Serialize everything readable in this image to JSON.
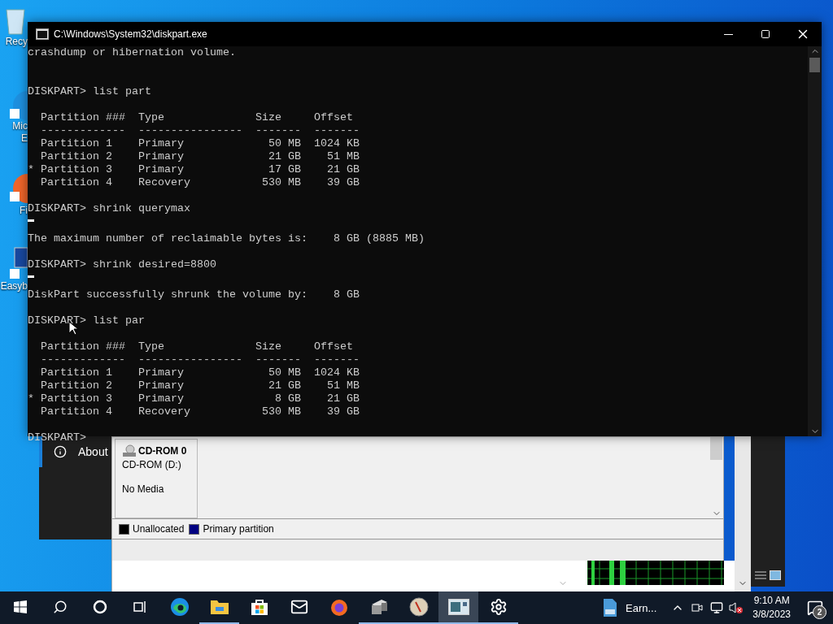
{
  "desktop_icons": [
    {
      "kind": "bin",
      "lines": [
        "Recy"
      ]
    },
    {
      "kind": "edge",
      "lines": [
        "Mic",
        "E"
      ]
    },
    {
      "kind": "firefox",
      "lines": [
        "Fi"
      ]
    },
    {
      "kind": "monitor",
      "lines": [
        "Easyb"
      ]
    }
  ],
  "settings_window": {
    "nav_item": {
      "label": "About",
      "selected": true
    }
  },
  "disk_management": {
    "device": {
      "name": "CD-ROM 0",
      "drive": "CD-ROM (D:)",
      "status": "No Media"
    },
    "legend": [
      {
        "label": "Unallocated",
        "color": "#000000"
      },
      {
        "label": "Primary partition",
        "color": "#000080"
      }
    ]
  },
  "console": {
    "title": "C:\\Windows\\System32\\diskpart.exe",
    "lines": [
      {
        "kind": "text",
        "text": "crashdump or hibernation volume."
      },
      {
        "kind": "blank"
      },
      {
        "kind": "blank"
      },
      {
        "kind": "text",
        "text": "DISKPART> list part"
      },
      {
        "kind": "blank"
      },
      {
        "kind": "text",
        "text": "  Partition ###  Type              Size     Offset"
      },
      {
        "kind": "text",
        "text": "  -------------  ----------------  -------  -------"
      },
      {
        "kind": "text",
        "text": "  Partition 1    Primary             50 MB  1024 KB"
      },
      {
        "kind": "text",
        "text": "  Partition 2    Primary             21 GB    51 MB"
      },
      {
        "kind": "text",
        "text": "* Partition 3    Primary             17 GB    21 GB"
      },
      {
        "kind": "text",
        "text": "  Partition 4    Recovery           530 MB    39 GB"
      },
      {
        "kind": "blank"
      },
      {
        "kind": "text",
        "text": "DISKPART> shrink querymax"
      },
      {
        "kind": "cursor"
      },
      {
        "kind": "text",
        "text": "The maximum number of reclaimable bytes is:    8 GB (8885 MB)"
      },
      {
        "kind": "blank"
      },
      {
        "kind": "text",
        "text": "DISKPART> shrink desired=8800"
      },
      {
        "kind": "cursor"
      },
      {
        "kind": "text",
        "text": "DiskPart successfully shrunk the volume by:    8 GB"
      },
      {
        "kind": "blank"
      },
      {
        "kind": "text",
        "text": "DISKPART> list par"
      },
      {
        "kind": "blank"
      },
      {
        "kind": "text",
        "text": "  Partition ###  Type              Size     Offset"
      },
      {
        "kind": "text",
        "text": "  -------------  ----------------  -------  -------"
      },
      {
        "kind": "text",
        "text": "  Partition 1    Primary             50 MB  1024 KB"
      },
      {
        "kind": "text",
        "text": "  Partition 2    Primary             21 GB    51 MB"
      },
      {
        "kind": "text",
        "text": "* Partition 3    Primary              8 GB    21 GB"
      },
      {
        "kind": "text",
        "text": "  Partition 4    Recovery           530 MB    39 GB"
      },
      {
        "kind": "blank"
      },
      {
        "kind": "text",
        "text": "DISKPART> "
      }
    ]
  },
  "taskbar": {
    "buttons": [
      {
        "kind": "start",
        "running": false,
        "selected": false
      },
      {
        "kind": "search",
        "running": false,
        "selected": false
      },
      {
        "kind": "cortana",
        "running": false,
        "selected": false
      },
      {
        "kind": "taskview",
        "running": false,
        "selected": false
      },
      {
        "kind": "edge",
        "running": false,
        "selected": false
      },
      {
        "kind": "explorer",
        "running": true,
        "selected": false
      },
      {
        "kind": "store",
        "running": false,
        "selected": false
      },
      {
        "kind": "mail",
        "running": false,
        "selected": false
      },
      {
        "kind": "firefox",
        "running": false,
        "selected": false
      },
      {
        "kind": "drives",
        "running": true,
        "selected": false
      },
      {
        "kind": "dial",
        "running": true,
        "selected": false
      },
      {
        "kind": "diskmgmt",
        "running": true,
        "selected": true
      },
      {
        "kind": "settings",
        "running": true,
        "selected": false
      }
    ],
    "widget": {
      "label": "Earn..."
    },
    "tray": [
      {
        "kind": "chevron"
      },
      {
        "kind": "camera"
      },
      {
        "kind": "network"
      },
      {
        "kind": "volume"
      }
    ],
    "clock": {
      "time": "9:10 AM",
      "date": "3/8/2023"
    },
    "notifications": {
      "count": "2"
    }
  }
}
